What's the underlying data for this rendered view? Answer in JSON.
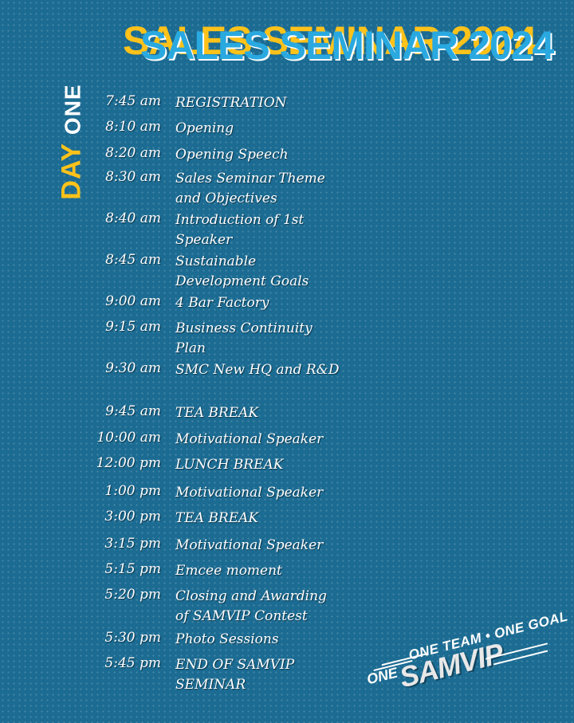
{
  "title": "SALES SEMINAR 2024",
  "day_label": {
    "first": "DAY",
    "second": "ONE"
  },
  "schedule": [
    {
      "time": "7:45 am",
      "event": "REGISTRATION"
    },
    {
      "time": "8:10 am",
      "event": "Opening"
    },
    {
      "time": "8:20 am",
      "event": "Opening Speech"
    },
    {
      "time": "8:30 am",
      "event": "Sales Seminar Theme and Objectives"
    },
    {
      "time": "8:40 am",
      "event": "Introduction of 1st Speaker"
    },
    {
      "time": "8:45 am",
      "event": "Sustainable Development Goals"
    },
    {
      "time": "9:00 am",
      "event": "4 Bar Factory"
    },
    {
      "time": "9:15 am",
      "event": "Business Continuity Plan"
    },
    {
      "time": "9:30 am",
      "event": "SMC New HQ and R&D"
    },
    {
      "time": "9:45 am",
      "event": "TEA BREAK"
    },
    {
      "time": "10:00 am",
      "event": "Motivational Speaker"
    },
    {
      "time": "12:00 pm",
      "event": "LUNCH BREAK"
    },
    {
      "time": "1:00 pm",
      "event": "Motivational Speaker"
    },
    {
      "time": "3:00 pm",
      "event": "TEA BREAK"
    },
    {
      "time": "3:15 pm",
      "event": "Motivational Speaker"
    },
    {
      "time": "5:15 pm",
      "event": "Emcee moment"
    },
    {
      "time": "5:20 pm",
      "event": "Closing and Awarding of SAMVIP Contest"
    },
    {
      "time": "5:30 pm",
      "event": "Photo Sessions"
    },
    {
      "time": "5:45 pm",
      "event": "END OF SAMVIP SEMINAR"
    }
  ],
  "logo": {
    "tagline": "ONE TEAM • ONE GOAL",
    "prefix": "ONE",
    "name": "SAMVIP"
  },
  "colors": {
    "background": "#1b6b92",
    "accent": "#ffc21a",
    "title_blue": "#29a9e0",
    "text": "#ffffff"
  }
}
